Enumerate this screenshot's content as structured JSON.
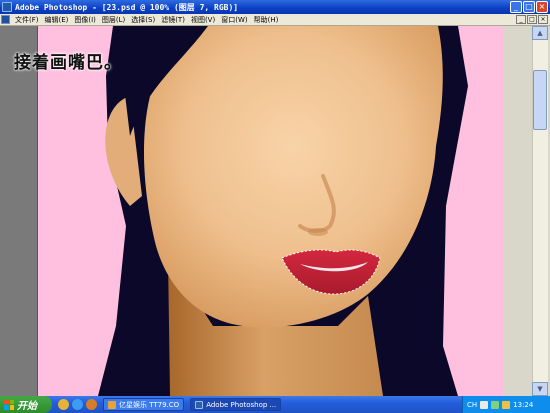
{
  "window": {
    "title": "Adobe Photoshop - [23.psd @ 100% (图层 7, RGB)]",
    "controls": [
      "_",
      "□",
      "×"
    ]
  },
  "menu": {
    "items": [
      "文件(F)",
      "编辑(E)",
      "图像(I)",
      "图层(L)",
      "选择(S)",
      "滤镜(T)",
      "视图(V)",
      "窗口(W)",
      "帮助(H)"
    ],
    "doc_controls": [
      "_",
      "□",
      "×"
    ]
  },
  "canvas": {
    "caption": "接着画嘴巴。",
    "colors": {
      "background": "#ffc0e0",
      "hair": "#0b0829",
      "skin": "#f3c696",
      "lips": "#c42036"
    }
  },
  "taskbar": {
    "start_label": "开始",
    "tasks": [
      {
        "label": "亿星娱乐 TT79.CO",
        "active": false
      },
      {
        "label": "Adobe Photoshop ...",
        "active": true
      }
    ],
    "tray": {
      "lang": "CH",
      "clock": "13:24"
    }
  }
}
